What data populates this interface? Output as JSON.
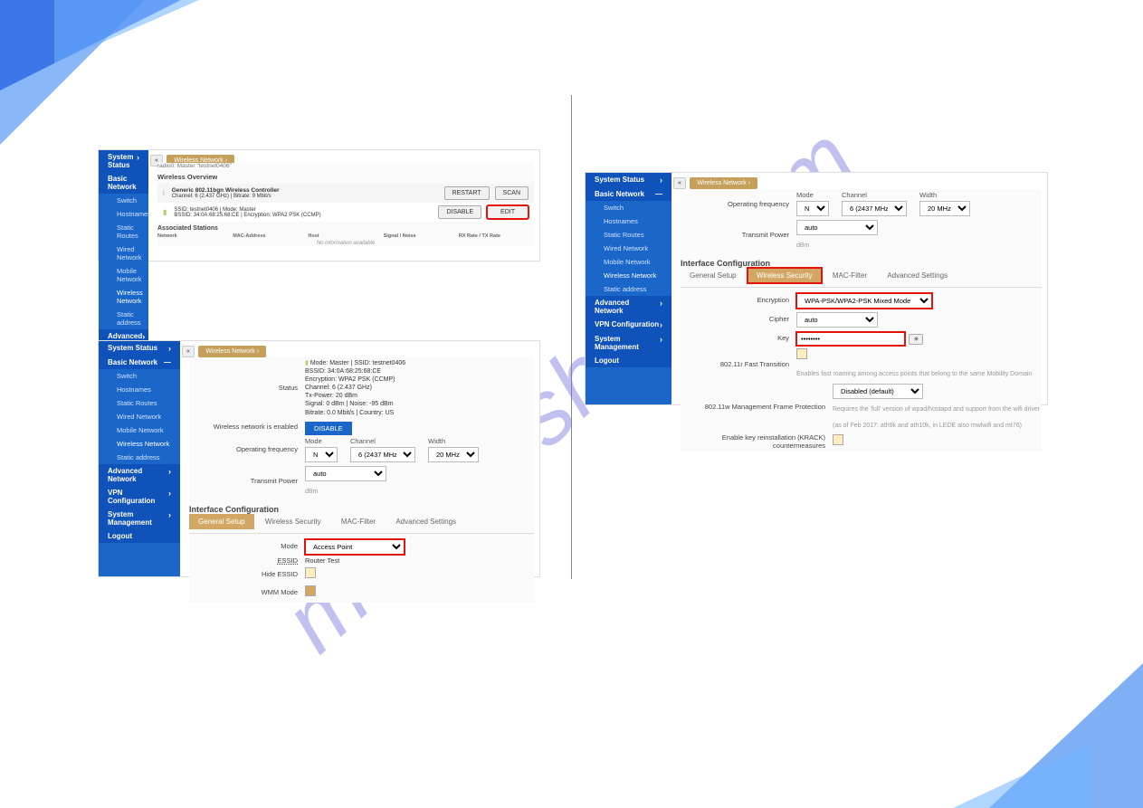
{
  "watermark": "manualshive.com",
  "nav": {
    "system_status": "System Status",
    "basic_network": "Basic Network",
    "advanced_network": "Advanced Network",
    "vpn_configuration": "VPN Configuration",
    "system_management": "System Management",
    "logout": "Logout",
    "items": {
      "switch": "Switch",
      "hostnames": "Hostnames",
      "static_routes": "Static Routes",
      "wired_network": "Wired Network",
      "mobile_network": "Mobile Network",
      "wireless_network": "Wireless Network",
      "static_address": "Static address"
    }
  },
  "breadcrumb_tab": "Wireless Network",
  "panel1": {
    "title_mini": "radio0: Master \"testnet0406\"",
    "overview_title": "Wireless Overview",
    "card_device": "Generic 802.11bgn Wireless Controller",
    "card_channel": "Channel: 6 (2.437 GHz) | Bitrate: 9 Mbit/s",
    "ssid_line1": "SSID: testnet0406 | Mode: Master",
    "ssid_line2": "BSSID: 34:0A:68:25:68:CE | Encryption: WPA2 PSK (CCMP)",
    "btn_restart": "RESTART",
    "btn_scan": "SCAN",
    "btn_disable": "DISABLE",
    "btn_edit": "EDIT",
    "assoc_title": "Associated Stations",
    "th_network": "Network",
    "th_mac": "MAC-Address",
    "th_host": "Host",
    "th_signal": "Signal / Noise",
    "th_rate": "RX Rate / TX Rate",
    "no_info": "No information available"
  },
  "panel2": {
    "status_label": "Status",
    "status": {
      "mode": "Mode: Master | SSID: testnet0406",
      "bssid": "BSSID: 34:0A:68:25:68:CE",
      "encryption": "Encryption: WPA2 PSK (CCMP)",
      "channel": "Channel: 6 (2.437 GHz)",
      "tx_power": "Tx-Power: 20 dBm",
      "signal": "Signal: 0 dBm | Noise: -95 dBm",
      "bitrate": "Bitrate: 0.0 Mbit/s | Country: US"
    },
    "enabled_label": "Wireless network is enabled",
    "disable_btn": "DISABLE",
    "freq_label": "Operating frequency",
    "mode_th": "Mode",
    "channel_th": "Channel",
    "width_th": "Width",
    "mode_val": "N",
    "channel_val": "6 (2437 MHz)",
    "width_val": "20 MHz",
    "txpower_label": "Transmit Power",
    "txpower_val": "auto",
    "dbm": "dBm",
    "iface_title": "Interface Configuration",
    "tabs": {
      "general": "General Setup",
      "security": "Wireless Security",
      "mac": "MAC-Filter",
      "adv": "Advanced Settings"
    },
    "mode_label": "Mode",
    "mode_select": "Access Point",
    "essid_label": "ESSID",
    "essid_val": "Router Test",
    "hide_label": "Hide ESSID",
    "wmm_label": "WMM Mode"
  },
  "panel3": {
    "freq_label": "Operating frequency",
    "mode_th": "Mode",
    "channel_th": "Channel",
    "width_th": "Width",
    "mode_val": "N",
    "channel_val": "6 (2437 MHz)",
    "width_val": "20 MHz",
    "txpower_label": "Transmit Power",
    "txpower_val": "auto",
    "dbm": "dBm",
    "iface_title": "Interface Configuration",
    "tabs": {
      "general": "General Setup",
      "security": "Wireless Security",
      "mac": "MAC-Filter",
      "adv": "Advanced Settings"
    },
    "enc_label": "Encryption",
    "enc_val": "WPA-PSK/WPA2-PSK Mixed Mode",
    "cipher_label": "Cipher",
    "cipher_val": "auto",
    "key_label": "Key",
    "key_val": "••••••••",
    "key_toggle": "✳",
    "ft_label": "802.11r Fast Transition",
    "ft_note": "Enables fast roaming among access points that belong to the same Mobility Domain",
    "mfp_label": "802.11w Management Frame Protection",
    "mfp_val": "Disabled (default)",
    "mfp_note1": "Requires the 'full' version of wpad/hostapd and support from the wifi driver",
    "mfp_note2": "(as of Feb 2017: ath9k and ath10k, in LEDE also mwlwifi and mt76)",
    "krack_label": "Enable key reinstallation (KRACK) countermeasures"
  }
}
